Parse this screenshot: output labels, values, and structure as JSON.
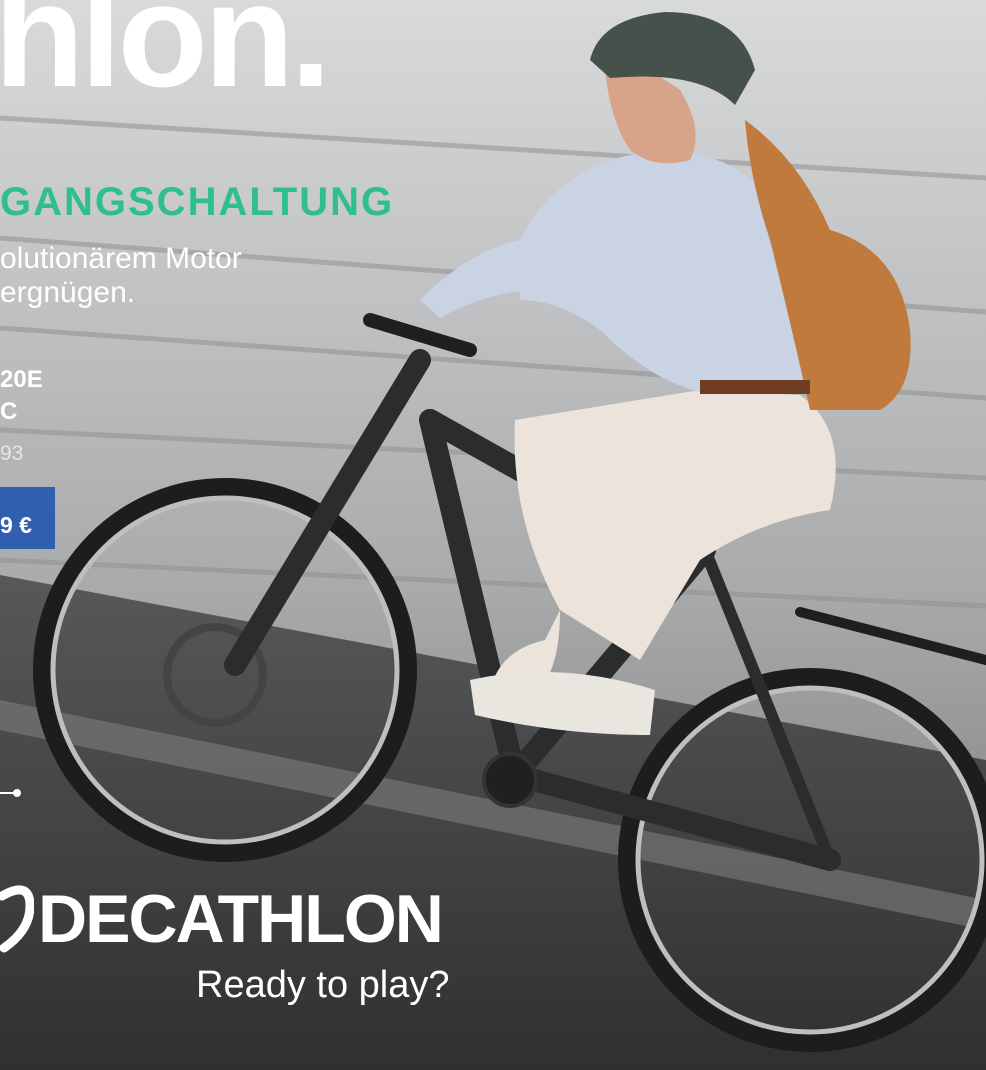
{
  "headline": "hlon.",
  "kicker": "GANGSCHALTUNG",
  "subline": [
    "olutionärem Motor",
    "ergnügen."
  ],
  "product": {
    "model_lines": [
      "20E",
      "C"
    ],
    "reference": "93",
    "price": "9 €"
  },
  "brand": {
    "wordmark": "DECATHLON",
    "slogan": "Ready to play?"
  },
  "icons": [
    "arrow-right-icon",
    "decathlon-logo-icon"
  ],
  "colors": {
    "headline": "#ffffff",
    "kicker": "#2fbf8f",
    "price_background": "#2f5fae",
    "text": "#ffffff"
  }
}
